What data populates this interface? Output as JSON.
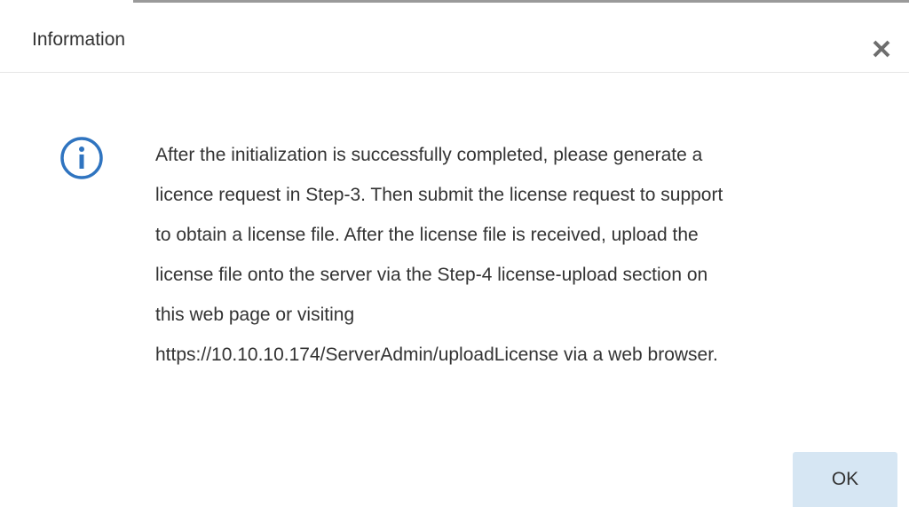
{
  "dialog": {
    "title": "Information",
    "close_icon": "close-icon",
    "info_icon": "info-circle-icon",
    "message_lines": [
      "After the initialization is successfully completed, please generate a",
      "licence request in Step-3. Then submit the license request to support",
      "to obtain a license file. After the license file is received, upload the",
      "license file onto the server via the Step-4 license-upload section on",
      "this web page or visiting",
      "https://10.10.10.174/ServerAdmin/uploadLicense via a web browser."
    ],
    "ok_label": "OK"
  },
  "colors": {
    "accent": "#2f74c0",
    "ok_button_bg": "#d6e6f3",
    "text": "#333333",
    "close_icon": "#6e6e6e"
  }
}
